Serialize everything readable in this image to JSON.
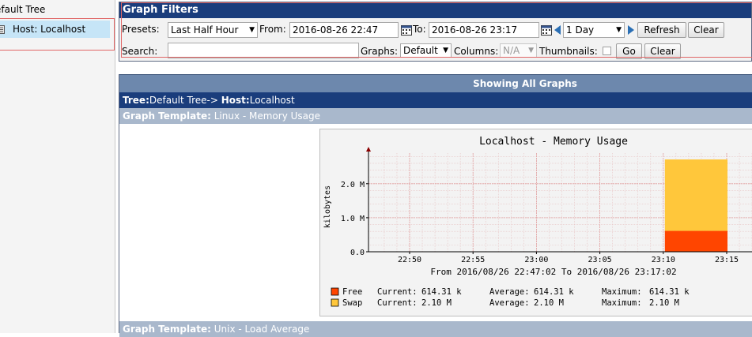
{
  "tree": {
    "root_label": "efault Tree",
    "host_label": "Host: Localhost"
  },
  "filters": {
    "title": "Graph Filters",
    "presets_label": "Presets:",
    "preset_value": "Last Half Hour",
    "from_label": "From:",
    "from_value": "2016-08-26 22:47",
    "to_label": "To:",
    "to_value": "2016-08-26 23:17",
    "timespan_value": "1 Day",
    "refresh_label": "Refresh",
    "clear_label": "Clear",
    "search_label": "Search:",
    "search_value": "",
    "graphs_label": "Graphs:",
    "graphs_value": "Default",
    "columns_label": "Columns:",
    "columns_value": "N/A",
    "thumbnails_label": "Thumbnails:",
    "thumbnails_checked": false,
    "go_label": "Go",
    "clear2_label": "Clear"
  },
  "graphs": {
    "showing_label": "Showing All Graphs",
    "tree_prefix": "Tree:",
    "tree_value": "Default Tree->",
    "host_prefix": "Host:",
    "host_value": "Localhost",
    "templates": [
      {
        "prefix": "Graph Template:",
        "name": "Linux - Memory Usage"
      },
      {
        "prefix": "Graph Template:",
        "name": "Unix - Load Average"
      }
    ]
  },
  "chart_data": {
    "type": "area",
    "title": "Localhost - Memory Usage",
    "ylabel": "kilobytes",
    "xlabel": "From 2016/08/26 22:47:02 To 2016/08/26 23:17:02",
    "x_ticks": [
      "22:50",
      "22:55",
      "23:00",
      "23:05",
      "23:10",
      "23:15"
    ],
    "y_ticks": [
      "0.0",
      "1.0 M",
      "2.0 M"
    ],
    "ylim": [
      0,
      2.9
    ],
    "y_unit": "M",
    "x_range": [
      "22:47:02",
      "23:17:02"
    ],
    "data_window": [
      "23:10",
      "23:15"
    ],
    "stacked": true,
    "series": [
      {
        "name": "Free",
        "color": "#ff4500",
        "value": 0.614,
        "current": "614.31 k",
        "average": "614.31 k",
        "maximum": "614.31 k"
      },
      {
        "name": "Swap",
        "color": "#ffc73b",
        "value": 2.1,
        "current": "2.10 M",
        "average": "2.10 M",
        "maximum": "2.10 M"
      }
    ],
    "legend_labels": {
      "current": "Current:",
      "average": "Average:",
      "maximum": "Maximum:"
    }
  }
}
